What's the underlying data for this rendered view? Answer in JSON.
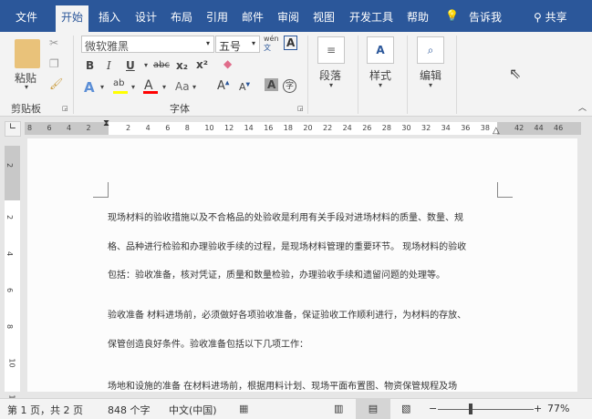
{
  "tabs": [
    "文件",
    "开始",
    "插入",
    "设计",
    "布局",
    "引用",
    "邮件",
    "审阅",
    "视图",
    "开发工具",
    "帮助"
  ],
  "active_tab": "开始",
  "tell_me": "告诉我",
  "share": "共享",
  "clipboard": {
    "paste": "粘贴",
    "group": "剪贴板"
  },
  "font": {
    "name": "微软雅黑",
    "size": "五号",
    "group": "字体",
    "bold": "B",
    "italic": "I",
    "underline": "U",
    "strike": "abc",
    "sub": "x₂",
    "sup": "x²",
    "case": "Aa",
    "phonetic": "wén",
    "phonetic2": "文",
    "border_a": "A",
    "enclose": "字",
    "highlight_color": "#ffff00",
    "font_color": "#ff0000"
  },
  "paragraph": {
    "label": "段落"
  },
  "styles": {
    "label": "样式"
  },
  "editing": {
    "label": "编辑"
  },
  "ruler": {
    "left": [
      "8",
      "6",
      "4",
      "2"
    ],
    "main": [
      "2",
      "4",
      "6",
      "8",
      "10",
      "12",
      "14",
      "16",
      "18",
      "20",
      "22",
      "24",
      "26",
      "28",
      "30",
      "32",
      "34",
      "36",
      "38"
    ],
    "right": [
      "42",
      "44",
      "46"
    ],
    "vertical": [
      "2",
      "2",
      "4",
      "6",
      "8",
      "10",
      "12"
    ]
  },
  "document": {
    "lines": [
      "现场材料的验收措施以及不合格品的处验收是利用有关手段对进场材料的质量、数量、规",
      "格、品种进行检验和办理验收手续的过程，是现场材料管理的重要环节。 现场材料的验收",
      "包括：验收准备，核对凭证，质量和数量检验，办理验收手续和遗留问题的处理等。",
      "验收准备 材料进场前，必须做好各项验收准备，保证验收工作顺利进行，为材料的存放、",
      "保管创造良好条件。验收准备包括以下几项工作：",
      "场地和设施的准备 在材料进场前，根据用料计划、现场平面布置图、物资保管规程及场"
    ]
  },
  "status": {
    "page": "第 1 页，共 2 页",
    "words": "848 个字",
    "language": "中文(中国)",
    "zoom": "77%",
    "zoom_level": 77
  },
  "accent": "#2b579a"
}
